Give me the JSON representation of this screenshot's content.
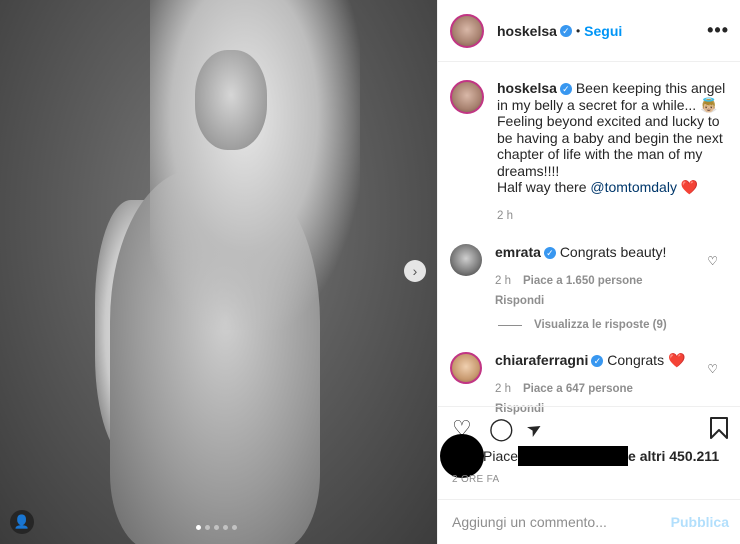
{
  "post": {
    "author": "hoskelsa",
    "follow_label": "Segui",
    "separator": "•",
    "more_icon": "•••",
    "next_icon": "›"
  },
  "caption": {
    "username": "hoskelsa",
    "text": "Been keeping this angel in my belly a secret for a while... 👼🏼 Feeling beyond excited and lucky to be having a baby and begin the next chapter of life with the man of my dreams!!!!",
    "line2_prefix": "Half way there ",
    "mention": "@tomtomdaly",
    "emoji": "❤️",
    "time": "2 h"
  },
  "comments": [
    {
      "username": "emrata",
      "text": "Congrats beauty!",
      "time": "2 h",
      "likes": "Piace a 1.650 persone",
      "reply": "Rispondi"
    },
    {
      "username": "chiaraferragni",
      "text": "Congrats ❤️",
      "time": "2 h",
      "likes": "Piace a 647 persone",
      "reply": "Rispondi"
    }
  ],
  "view_replies": "Visualizza le risposte (9)",
  "actions": {
    "like_icon": "♡",
    "comment_icon": "◯",
    "share_icon": "➤",
    "save_icon": "🔖"
  },
  "likes": {
    "prefix": "Piace",
    "suffix": "e altri 450.211"
  },
  "time_ago": "2 ORE FA",
  "add_comment": {
    "placeholder": "Aggiungi un commento...",
    "post_label": "Pubblica"
  },
  "colors": {
    "accent": "#0095f6",
    "verified": "#3897f0",
    "muted": "#8e8e8e",
    "heart": "#ed4956"
  }
}
